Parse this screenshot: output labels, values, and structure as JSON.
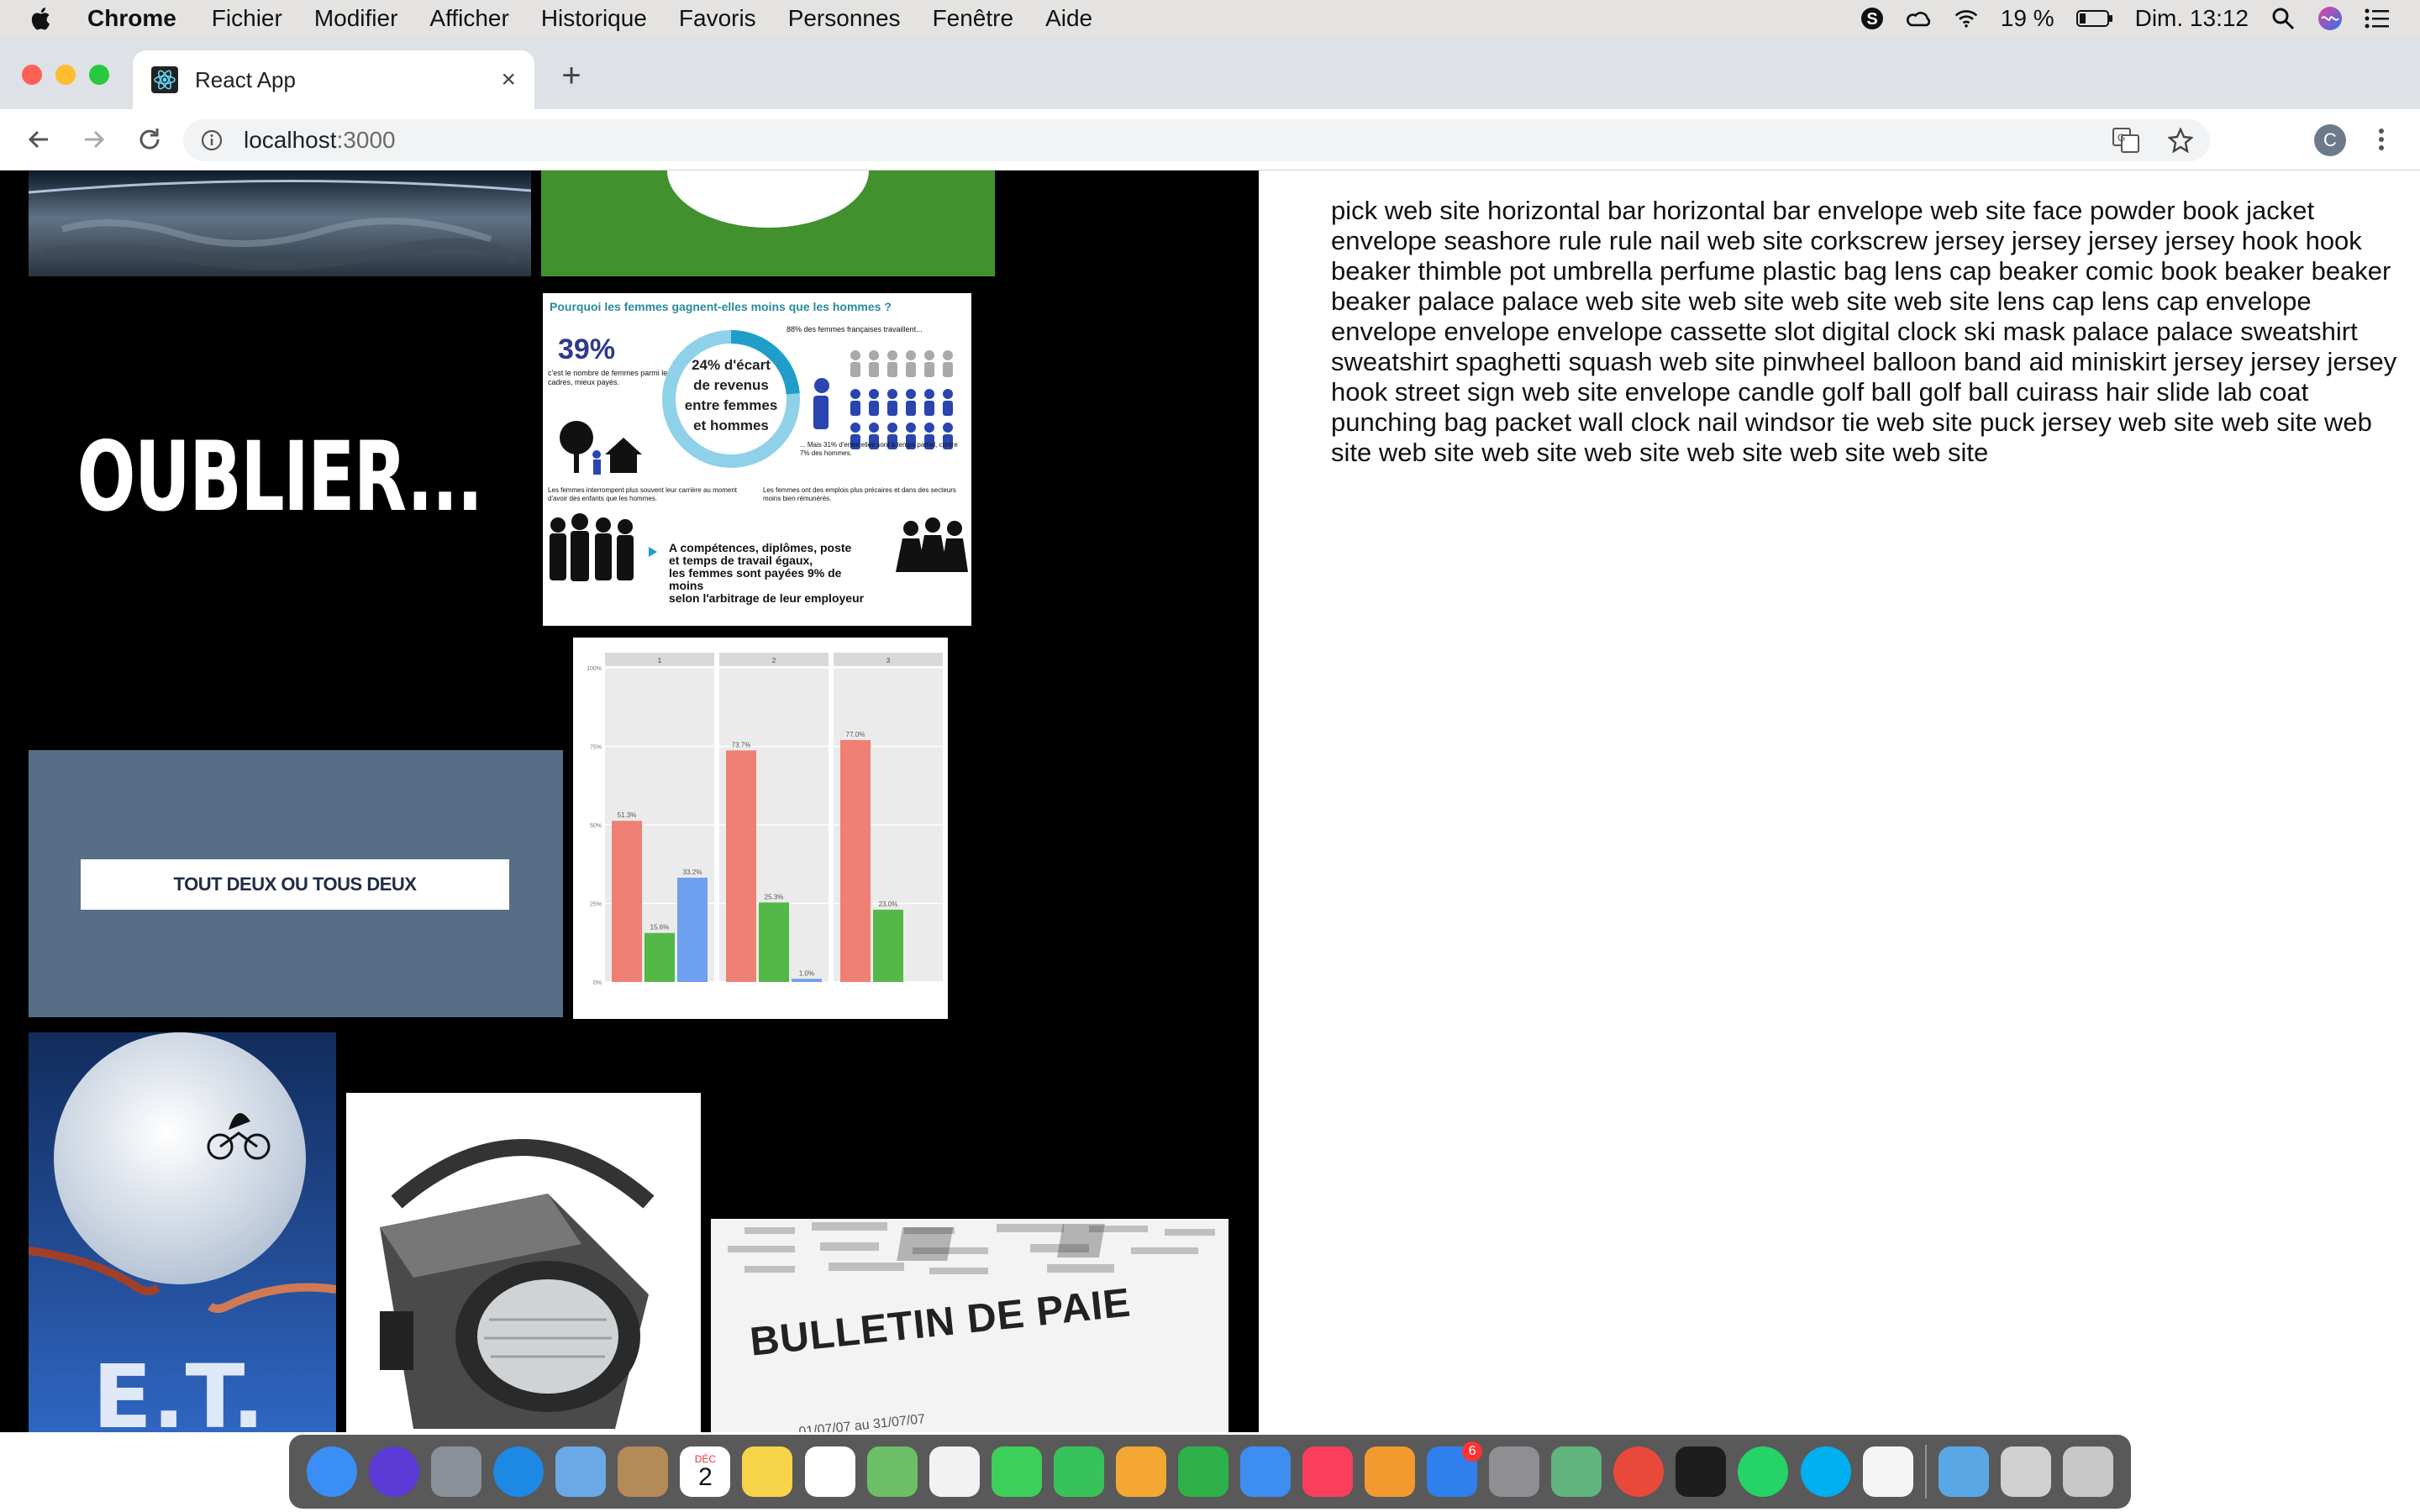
{
  "menubar": {
    "app": "Chrome",
    "items": [
      "Fichier",
      "Modifier",
      "Afficher",
      "Historique",
      "Favoris",
      "Personnes",
      "Fenêtre",
      "Aide"
    ],
    "battery": "19 %",
    "clock": "Dim. 13:12"
  },
  "browser": {
    "tab_title": "React App",
    "close_glyph": "×",
    "new_tab_glyph": "+",
    "url_host": "localhost",
    "url_port": ":3000",
    "avatar_letter": "C"
  },
  "left_images": {
    "oublier": "OUBLIER...",
    "infographic": {
      "title": "Pourquoi les femmes gagnent-elles moins que les hommes ?",
      "stat": "39%",
      "stat_caption": "c'est le nombre de femmes parmi les cadres, mieux payés.",
      "gap_line1": "24% d'écart",
      "gap_line2": "de revenus",
      "gap_line3": "entre femmes",
      "gap_line4": "et hommes",
      "top_right": "88% des femmes françaises travaillent...",
      "part_time": "... Mais 31% d'entre elles sont à temps partiel, contre 7% des hommes.",
      "career": "Les femmes interrompent plus souvent leur carrière au moment d'avoir des enfants que les hommes.",
      "jobs": "Les femmes ont des emplois plus précaires et dans des secteurs moins bien rémunérés.",
      "bottom_line1": "A compétences, diplômes, poste",
      "bottom_line2": "et temps de travail égaux,",
      "bottom_line3": "les femmes sont payées 9% de moins",
      "bottom_line4": "selon l'arbitrage de leur employeur"
    },
    "tout_deux": "TOUT DEUX OU TOUS DEUX",
    "et": "E.T.",
    "bulletin": "BULLETIN DE PAIE"
  },
  "chart_data": {
    "type": "bar",
    "title": "",
    "panels": [
      "1",
      "2",
      "3"
    ],
    "categories": [
      "",
      "",
      ""
    ],
    "ylim": [
      0,
      100
    ],
    "yticks": [
      "0%",
      "25%",
      "50%",
      "75%",
      "100%"
    ],
    "series_colors": [
      "#ef8073",
      "#54b848",
      "#6f9fef"
    ],
    "values": [
      [
        51.3,
        15.6,
        33.2
      ],
      [
        73.7,
        25.3,
        1.0
      ],
      [
        77.0,
        23.0,
        0
      ]
    ],
    "labels": [
      [
        "51.3%",
        "15.6%",
        "33.2%"
      ],
      [
        "73.7%",
        "25.3%",
        "1.0%"
      ],
      [
        "77.0%",
        "23.0%",
        ""
      ]
    ]
  },
  "right_text": "pick web site horizontal bar horizontal bar envelope web site face powder book jacket envelope seashore rule rule nail web site corkscrew jersey jersey jersey jersey hook hook beaker thimble pot umbrella perfume plastic bag lens cap beaker comic book beaker beaker beaker palace palace web site web site web site web site lens cap lens cap envelope envelope envelope envelope cassette slot digital clock ski mask palace palace sweatshirt sweatshirt spaghetti squash web site pinwheel balloon band aid miniskirt jersey jersey jersey hook street sign web site envelope candle golf ball golf ball cuirass hair slide lab coat punching bag packet wall clock nail windsor tie web site puck jersey web site web site web site web site web site web site web site web site web site",
  "dock": {
    "calendar_month": "DÉC",
    "calendar_day": "2",
    "appstore_badge": "6",
    "apps": [
      "finder",
      "siri",
      "launchpad",
      "safari",
      "mail",
      "contacts",
      "calendar",
      "notes",
      "reminders",
      "maps",
      "photos",
      "messages",
      "facetime",
      "pages",
      "numbers",
      "keynote",
      "music",
      "books",
      "app-store",
      "system-preferences",
      "atom",
      "chrome",
      "terminal",
      "whatsapp",
      "skype",
      "textedit",
      "downloads",
      "preview",
      "trash"
    ],
    "colors": {
      "finder": "#3a8ef6",
      "siri": "#5b3ad6",
      "launchpad": "#8a8f99",
      "safari": "#1e88e5",
      "mail": "#6aa8e8",
      "contacts": "#b38a58",
      "calendar": "#ffffff",
      "notes": "#f7d34a",
      "reminders": "#ffffff",
      "maps": "#6dbf67",
      "photos": "#f2f2f2",
      "messages": "#3ecf5a",
      "facetime": "#38c25a",
      "pages": "#f4a733",
      "numbers": "#2fb14a",
      "keynote": "#3d8ef0",
      "music": "#fb3e5c",
      "books": "#f29a2e",
      "app-store": "#2f80ed",
      "system-preferences": "#8e8e93",
      "atom": "#5fb57d",
      "chrome": "#e9493a",
      "terminal": "#1d1d1d",
      "whatsapp": "#25d366",
      "skype": "#00aff0",
      "textedit": "#f5f5f5",
      "downloads": "#5aa7e6",
      "preview": "#d0d0d0",
      "trash": "#c8c8c8"
    }
  }
}
